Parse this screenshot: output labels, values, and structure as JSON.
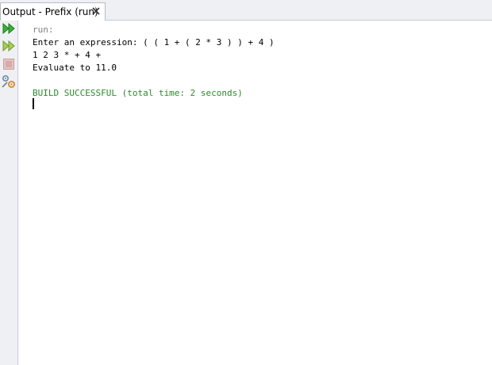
{
  "tab": {
    "title": "Output - Prefix (run)",
    "close_icon": "close-icon"
  },
  "toolbar": {
    "buttons": [
      {
        "name": "rerun-icon",
        "color": "#3aa53a"
      },
      {
        "name": "rerun-with-options-icon",
        "color": "#8dbf3a"
      },
      {
        "name": "stop-icon",
        "color": "#d9a9a9"
      },
      {
        "name": "settings-icon",
        "color": "#7a8ea8"
      }
    ]
  },
  "console": {
    "run_line": "run:",
    "lines": [
      "Enter an expression: ( ( 1 + ( 2 * 3 ) ) + 4 )",
      "1 2 3 * + 4 +",
      "Evaluate to 11.0"
    ],
    "build_line": "BUILD SUCCESSFUL (total time: 2 seconds)",
    "colors": {
      "run": "#808080",
      "text": "#000000",
      "build": "#2a8a2a"
    }
  }
}
